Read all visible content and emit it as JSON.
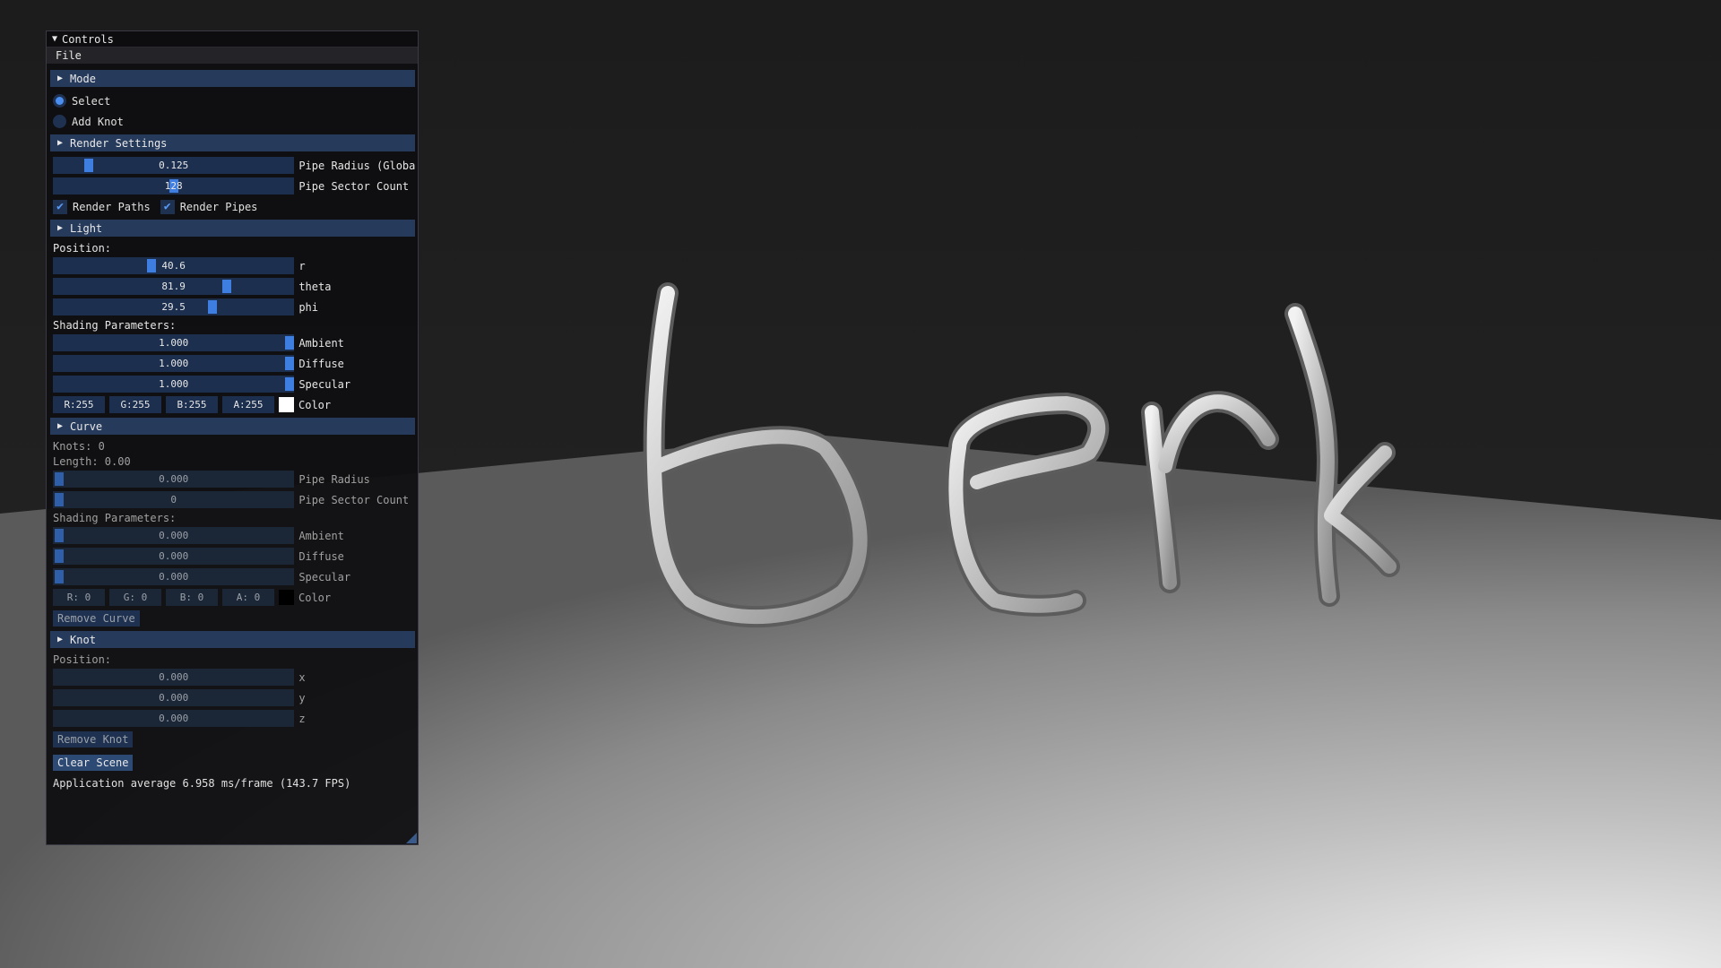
{
  "window": {
    "title": "Controls",
    "menu": [
      "File"
    ]
  },
  "mode": {
    "header": "Mode",
    "options": [
      {
        "label": "Select",
        "selected": true
      },
      {
        "label": "Add Knot",
        "selected": false
      }
    ]
  },
  "render": {
    "header": "Render Settings",
    "pipe_radius": {
      "value": "0.125",
      "label": "Pipe Radius (Global"
    },
    "pipe_sector": {
      "value": "128",
      "label": "Pipe Sector Count ("
    },
    "render_paths": {
      "label": "Render Paths",
      "checked": true
    },
    "render_pipes": {
      "label": "Render Pipes",
      "checked": true
    }
  },
  "light": {
    "header": "Light",
    "position_label": "Position:",
    "r": {
      "value": "40.6",
      "label": "r"
    },
    "theta": {
      "value": "81.9",
      "label": "theta"
    },
    "phi": {
      "value": "29.5",
      "label": "phi"
    },
    "shading_label": "Shading Parameters:",
    "ambient": {
      "value": "1.000",
      "label": "Ambient"
    },
    "diffuse": {
      "value": "1.000",
      "label": "Diffuse"
    },
    "specular": {
      "value": "1.000",
      "label": "Specular"
    },
    "color": {
      "r": "R:255",
      "g": "G:255",
      "b": "B:255",
      "a": "A:255",
      "label": "Color",
      "swatch": "#ffffff"
    }
  },
  "curve": {
    "header": "Curve",
    "knots": "Knots: 0",
    "length": "Length: 0.00",
    "pipe_radius": {
      "value": "0.000",
      "label": "Pipe Radius"
    },
    "pipe_sector": {
      "value": "0",
      "label": "Pipe Sector Count"
    },
    "shading_label": "Shading Parameters:",
    "ambient": {
      "value": "0.000",
      "label": "Ambient"
    },
    "diffuse": {
      "value": "0.000",
      "label": "Diffuse"
    },
    "specular": {
      "value": "0.000",
      "label": "Specular"
    },
    "color": {
      "r": "R:  0",
      "g": "G:  0",
      "b": "B:  0",
      "a": "A:  0",
      "label": "Color",
      "swatch": "#000000"
    },
    "remove_button": "Remove Curve"
  },
  "knot": {
    "header": "Knot",
    "position_label": "Position:",
    "x": {
      "value": "0.000",
      "label": "x"
    },
    "y": {
      "value": "0.000",
      "label": "y"
    },
    "z": {
      "value": "0.000",
      "label": "z"
    },
    "remove_button": "Remove Knot"
  },
  "clear_button": "Clear Scene",
  "status": "Application average 6.958 ms/frame (143.7 FPS)",
  "colors": {
    "accent": "#3d7ee0",
    "header": "#263a5c",
    "frame": "#1d2f4e"
  }
}
